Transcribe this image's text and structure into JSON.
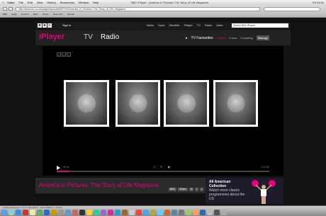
{
  "mac_menu": {
    "apple": "",
    "items": [
      "Safari",
      "File",
      "Edit",
      "View",
      "History",
      "Bookmarks",
      "Window",
      "Help"
    ],
    "clock": "Fri 12:41"
  },
  "browser": {
    "window_title": "BBC iPlayer - America in Pictures: The Story of Life Magazine",
    "url": "http://www.bbc.co.uk/iplayer/episode/b00?/ref/America_in_Pictures_The_Story_of_Life_Magazine",
    "bookmarks": [
      "BBC",
      "Apple",
      "Amazon",
      "eBay",
      "Yahoo!",
      "News (52)",
      "Popular"
    ]
  },
  "bbc_bar": {
    "logo": [
      "B",
      "B",
      "C"
    ],
    "sign_in": "Sign in",
    "nav": [
      "News",
      "Sport",
      "Weather",
      "iPlayer",
      "TV",
      "Radio",
      "More"
    ],
    "search_placeholder": "Search BBC iPlayer"
  },
  "iplayer": {
    "logo": "iPlayer",
    "tab_tv": "TV",
    "tab_radio": "Radio",
    "favourites": "TV Favourites",
    "items": "0 items",
    "new": "0 new",
    "expiring": "0 expiring",
    "manage": "Manage"
  },
  "player": {
    "watermark": [
      "B",
      "B",
      "C"
    ],
    "time_current": "00:01",
    "time_total": "1:00:00",
    "progress": 0.06,
    "controls": [
      "⤢",
      "✎",
      "◀)"
    ]
  },
  "info": {
    "title": "America in Pictures: The Story of Life Magazine",
    "share": [
      "BBC",
      "Share",
      "",
      "",
      ""
    ]
  },
  "promo": {
    "heading": "All American Collection",
    "body": "Watch more classic programmes about the US"
  },
  "colors": {
    "accent": "#e6007e",
    "player_bg": "#000000",
    "page_bg": "#111111"
  },
  "status_text": "Loading Messages: 6 of 6, Information: Check Mailbox + Activity"
}
